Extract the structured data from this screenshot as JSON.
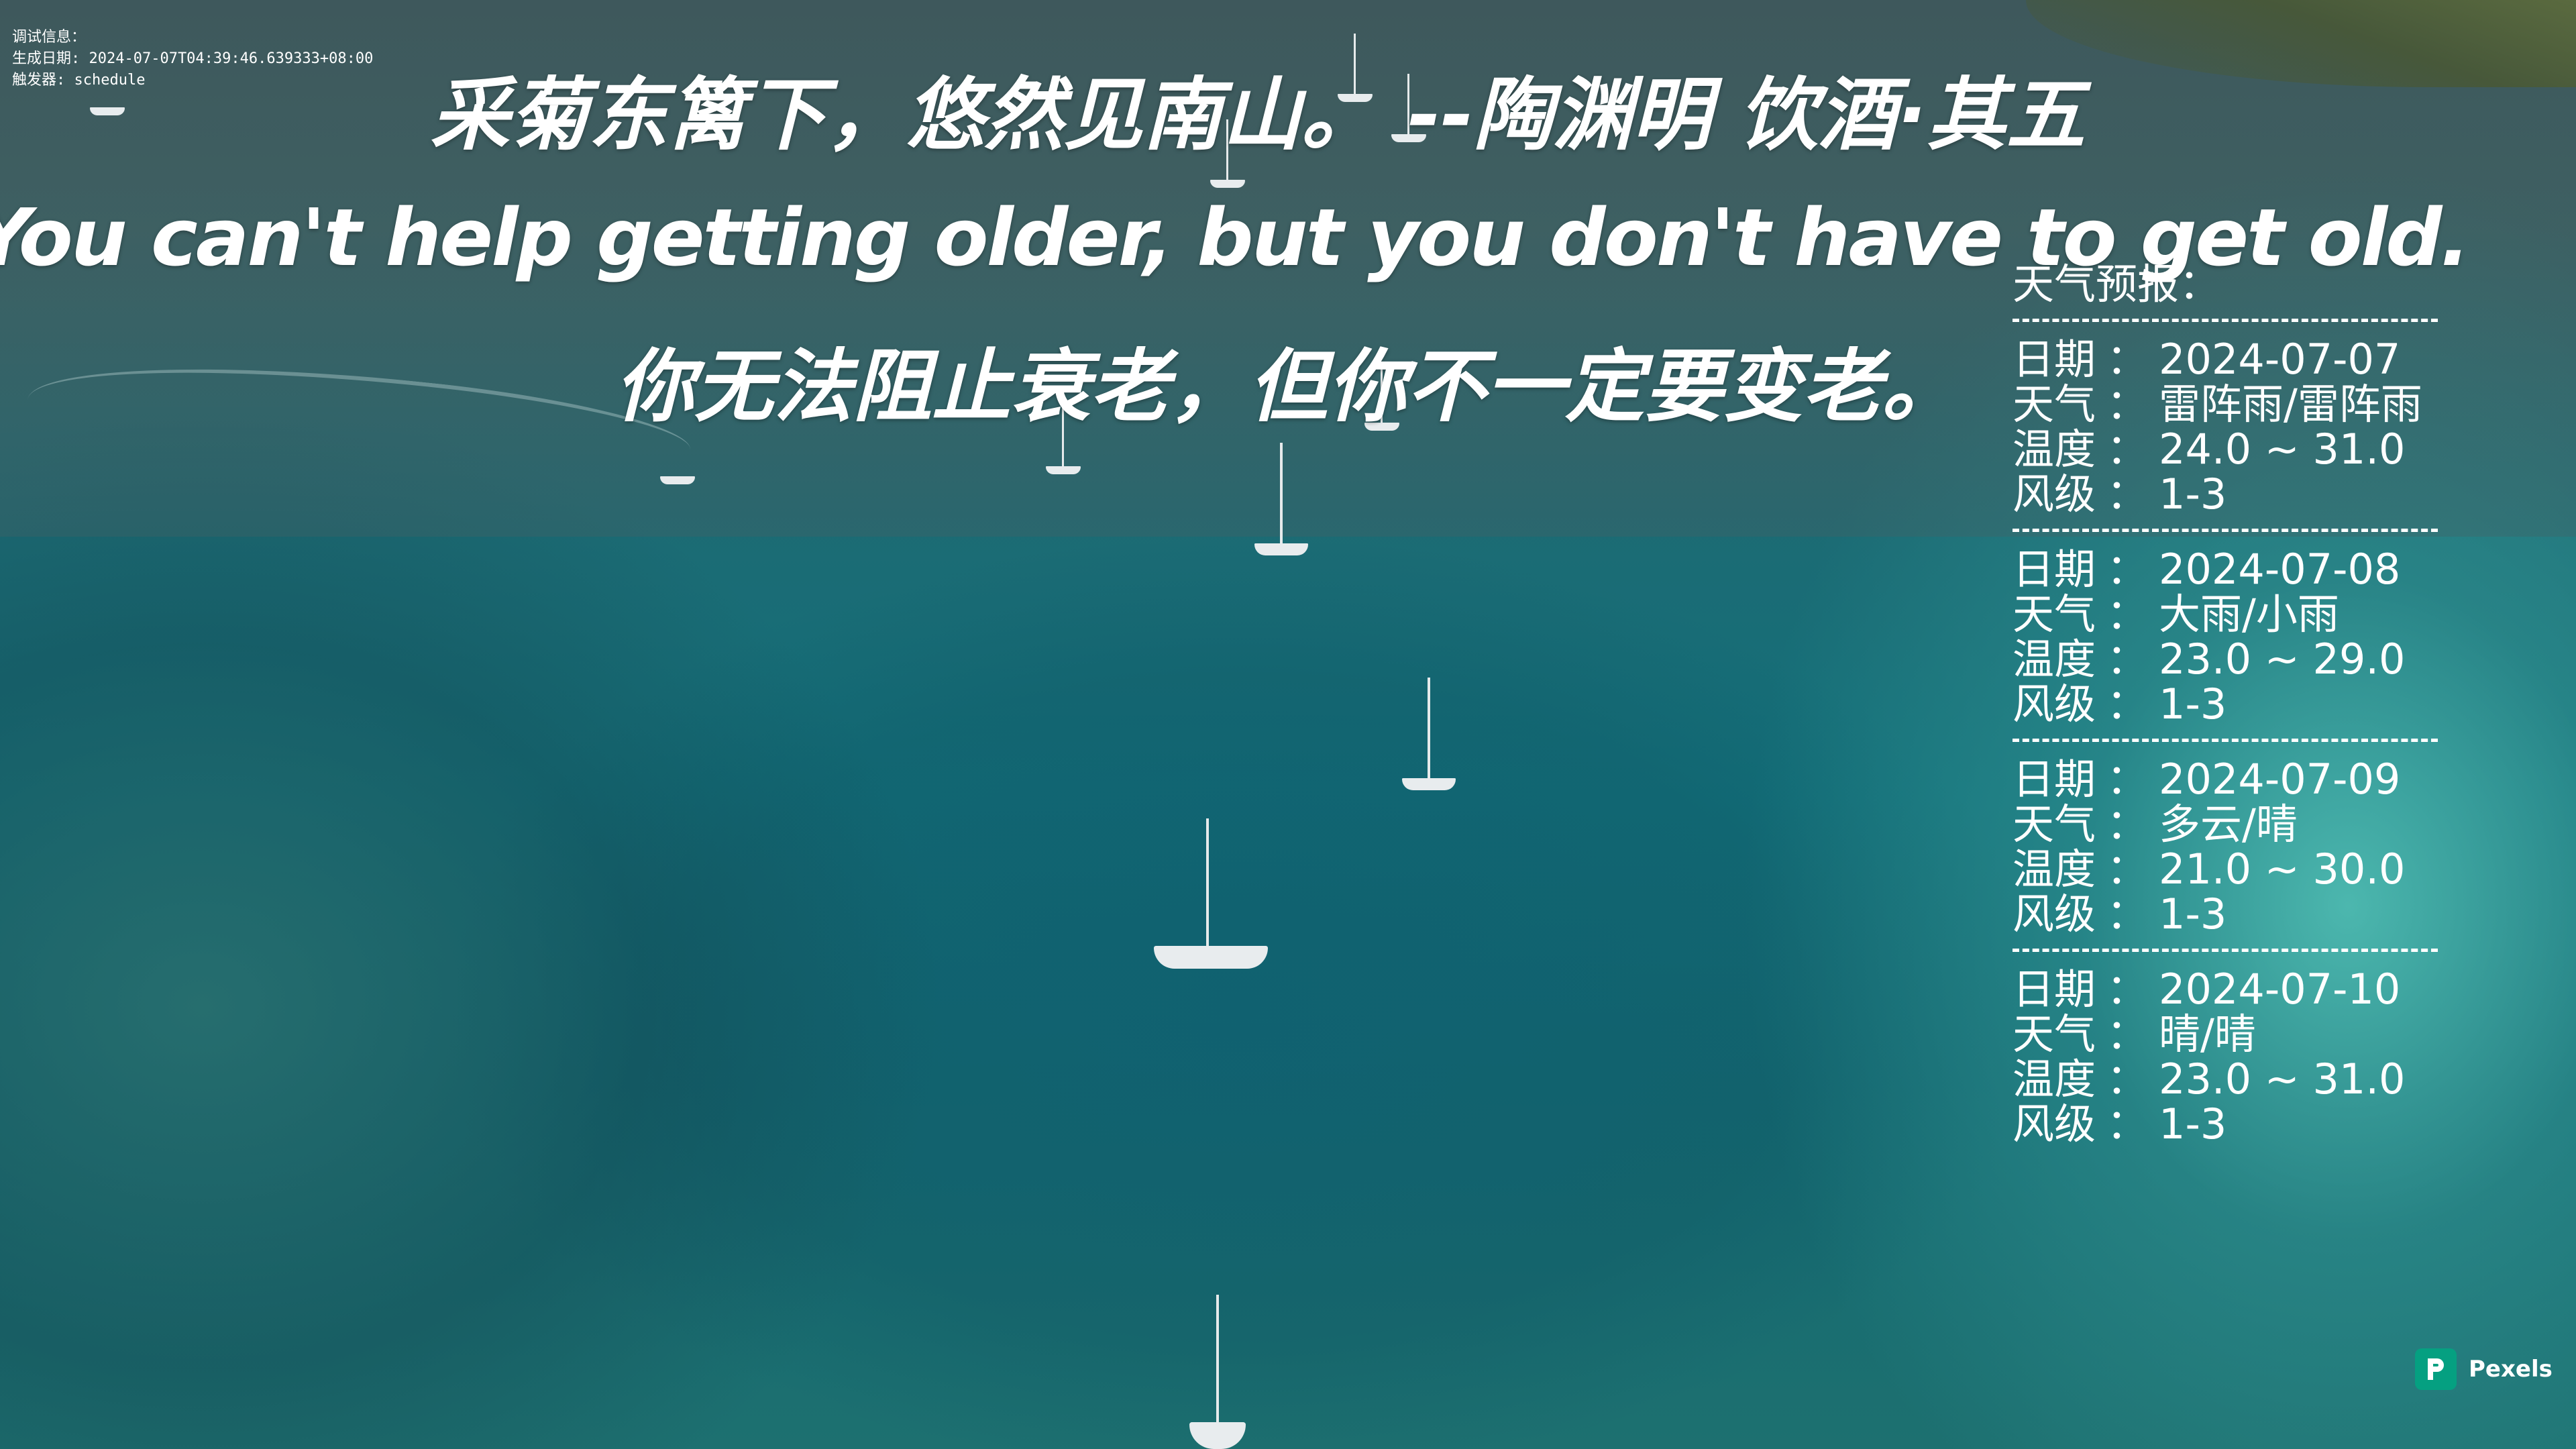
{
  "debug": {
    "line1": "调试信息：",
    "line2": "生成日期: 2024-07-07T04:39:46.639333+08:00",
    "line3": "触发器: schedule"
  },
  "quote": {
    "poem": "采菊东篱下，悠然见南山。 --陶渊明 饮酒·其五",
    "english": "You can't help getting older, but you don't have to get old.",
    "chinese": "你无法阻止衰老，但你不一定要变老。"
  },
  "weather": {
    "title": "天气预报：",
    "divider": "-----------------------------",
    "labels": {
      "date": "日期",
      "weather": "天气",
      "temp": "温度",
      "wind": "风级",
      "sep": "："
    },
    "days": [
      {
        "date": "2024-07-07",
        "weather": "雷阵雨/雷阵雨",
        "temp": "24.0 ~ 31.0",
        "wind": "1-3"
      },
      {
        "date": "2024-07-08",
        "weather": "大雨/小雨",
        "temp": "23.0 ~ 29.0",
        "wind": "1-3"
      },
      {
        "date": "2024-07-09",
        "weather": "多云/晴",
        "temp": "21.0 ~ 30.0",
        "wind": "1-3"
      },
      {
        "date": "2024-07-10",
        "weather": "晴/晴",
        "temp": "23.0 ~ 31.0",
        "wind": "1-3"
      }
    ]
  },
  "credit": {
    "label": "Pexels",
    "icon": "pexels-logo-icon",
    "color": "#05a081"
  }
}
